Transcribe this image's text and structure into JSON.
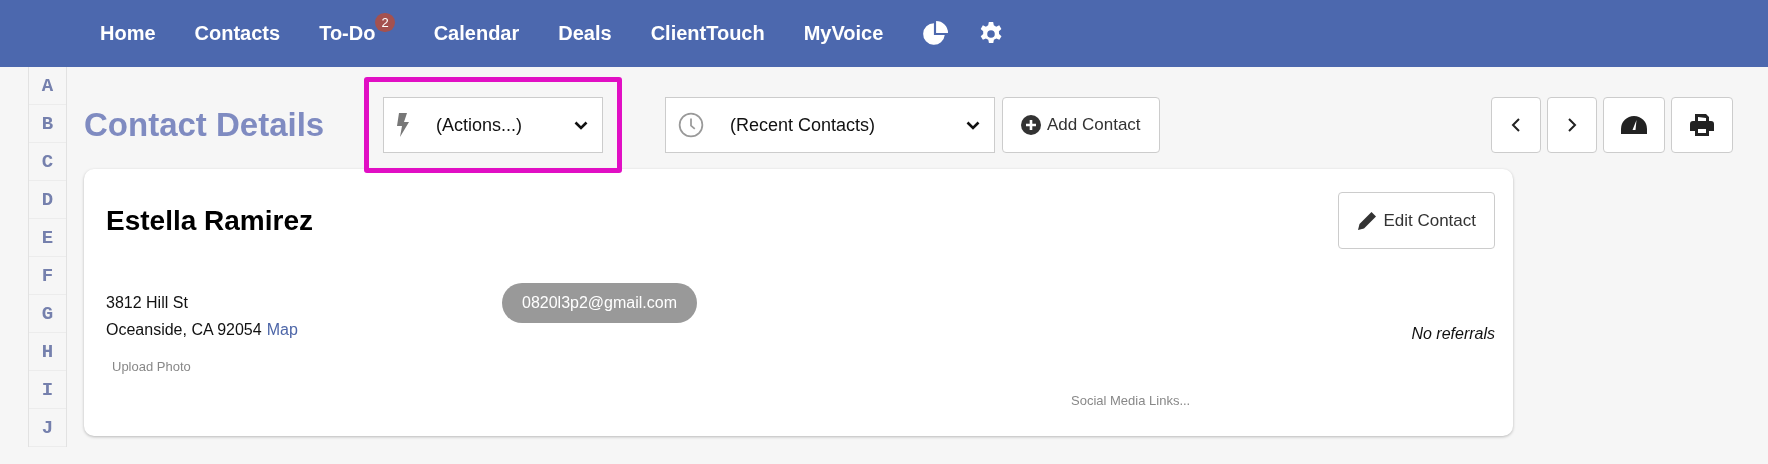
{
  "nav": {
    "items": [
      {
        "label": "Home"
      },
      {
        "label": "Contacts"
      },
      {
        "label": "To-Do",
        "badge": "2"
      },
      {
        "label": "Calendar"
      },
      {
        "label": "Deals"
      },
      {
        "label": "ClientTouch"
      },
      {
        "label": "MyVoice"
      }
    ]
  },
  "alphabet": [
    "A",
    "B",
    "C",
    "D",
    "E",
    "F",
    "G",
    "H",
    "I",
    "J"
  ],
  "title": "Contact Details",
  "actions_select": {
    "value": "(Actions...)",
    "highlighted": true
  },
  "recent_select": {
    "value": "(Recent Contacts)"
  },
  "add_button": "Add Contact",
  "contact": {
    "name": "Estella Ramirez",
    "edit_button": "Edit Contact",
    "address_lines": [
      "3812 Hill St",
      "Oceanside, CA 92054"
    ],
    "map_link": "Map",
    "email": "0820l3p2@gmail.com",
    "referrals": "No referrals",
    "upload_photo": "Upload Photo",
    "social_links": "Social Media Links..."
  }
}
